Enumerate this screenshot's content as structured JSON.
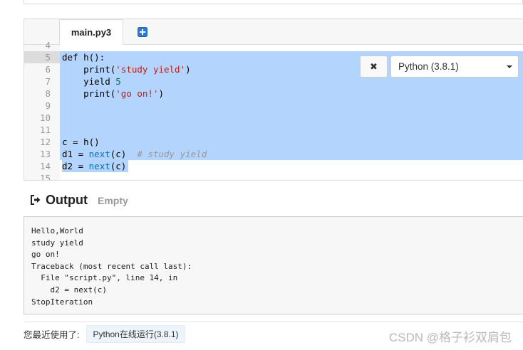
{
  "tabs": [
    {
      "label": "main.py3",
      "active": true
    }
  ],
  "add_tab_icon": "plus-square-icon",
  "editor": {
    "lines": [
      {
        "num": "4",
        "code": ""
      },
      {
        "num": "5",
        "code": "def h():"
      },
      {
        "num": "6",
        "code": "    print('study yield')"
      },
      {
        "num": "7",
        "code": "    yield 5"
      },
      {
        "num": "8",
        "code": "    print('go on!')"
      },
      {
        "num": "9",
        "code": ""
      },
      {
        "num": "10",
        "code": ""
      },
      {
        "num": "11",
        "code": ""
      },
      {
        "num": "12",
        "code": "c = h()"
      },
      {
        "num": "13",
        "code": "d1 = next(c)  # study yield"
      },
      {
        "num": "14",
        "code": "d2 = next(c)"
      },
      {
        "num": "15",
        "code": ""
      }
    ],
    "selection_color": "#b3d4fc"
  },
  "toolbar": {
    "close_label": "✖",
    "language_selected": "Python (3.8.1)"
  },
  "output": {
    "title": "Output",
    "status": "Empty",
    "text": "Hello,World\nstudy yield\ngo on!\nTraceback (most recent call last):\n  File \"script.py\", line 14, in \n    d2 = next(c)\nStopIteration"
  },
  "recent": {
    "label": "您最近使用了:",
    "item": "Python在线运行(3.8.1)"
  },
  "watermark": "CSDN @格子衫双肩包"
}
